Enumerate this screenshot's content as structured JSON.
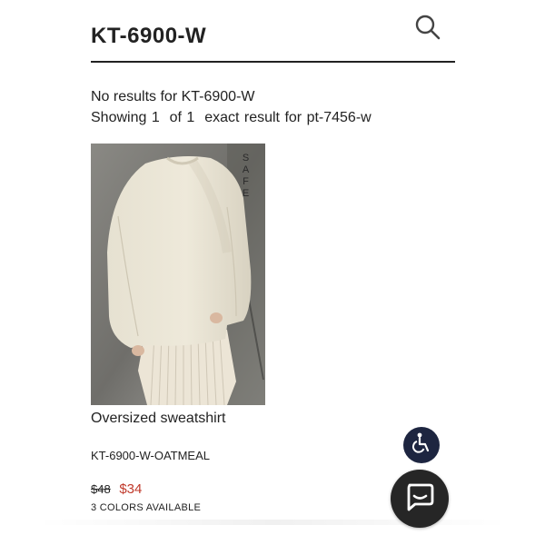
{
  "header": {
    "search_query": "KT-6900-W",
    "search_icon": "search-icon"
  },
  "results": {
    "no_results_text": "No results for KT-6900-W",
    "showing_text": "Showing 1  of 1  exact result for pt-7456-w"
  },
  "product": {
    "image_watermark": "SAFE",
    "name": "Oversized sweatshirt",
    "sku": "KT-6900-W-OATMEAL",
    "price_original": "$48",
    "price_sale": "$34",
    "colors_available": "3 COLORS AVAILABLE"
  },
  "floating": {
    "accessibility_icon": "accessibility-icon",
    "chat_icon": "chat-bubble-icon"
  },
  "colors": {
    "text": "#222222",
    "sale_price": "#c0392b",
    "accessibility_bg": "#1d2540",
    "chat_bg": "#262626"
  }
}
